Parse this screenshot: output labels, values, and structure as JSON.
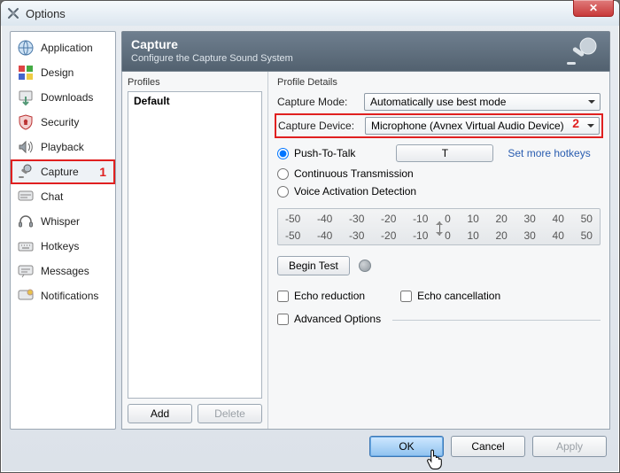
{
  "window": {
    "title": "Options"
  },
  "sidebar": {
    "items": [
      {
        "label": "Application"
      },
      {
        "label": "Design"
      },
      {
        "label": "Downloads"
      },
      {
        "label": "Security"
      },
      {
        "label": "Playback"
      },
      {
        "label": "Capture"
      },
      {
        "label": "Chat"
      },
      {
        "label": "Whisper"
      },
      {
        "label": "Hotkeys"
      },
      {
        "label": "Messages"
      },
      {
        "label": "Notifications"
      }
    ],
    "selected_index": 5,
    "badge1": "1"
  },
  "header": {
    "title": "Capture",
    "subtitle": "Configure the Capture Sound System"
  },
  "profiles": {
    "section_label": "Profiles",
    "items": [
      "Default"
    ],
    "add_label": "Add",
    "delete_label": "Delete"
  },
  "details": {
    "section_label": "Profile Details",
    "capture_mode_label": "Capture Mode:",
    "capture_mode_value": "Automatically use best mode",
    "capture_device_label": "Capture Device:",
    "capture_device_value": "Microphone (Avnex Virtual Audio Device)",
    "badge2": "2",
    "ptt_label": "Push-To-Talk",
    "ptt_hotkey": "T",
    "set_more_label": "Set more hotkeys",
    "cont_label": "Continuous Transmission",
    "vad_label": "Voice Activation Detection",
    "meter_ticks": [
      "-50",
      "-40",
      "-30",
      "-20",
      "-10",
      "0",
      "10",
      "20",
      "30",
      "40",
      "50"
    ],
    "begin_test_label": "Begin Test",
    "echo_reduction_label": "Echo reduction",
    "echo_cancellation_label": "Echo cancellation",
    "advanced_label": "Advanced Options"
  },
  "footer": {
    "ok": "OK",
    "cancel": "Cancel",
    "apply": "Apply"
  }
}
